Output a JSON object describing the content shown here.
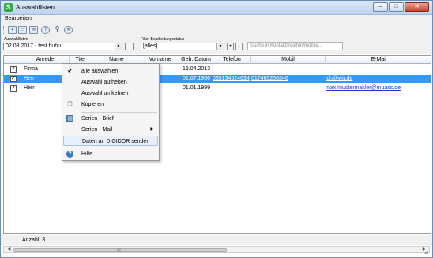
{
  "window": {
    "title": "Auswahllisten",
    "app_icon": "S"
  },
  "menu": {
    "items": [
      "Bearbeiten"
    ]
  },
  "toolbar": {
    "icons": [
      "save-icon",
      "print-icon",
      "mail-icon",
      "help-icon",
      "settings-icon",
      "close-circle-icon"
    ]
  },
  "filters": {
    "list_label": "Auswahllisten",
    "list_value": "02.03.2017  -  test huhu",
    "ellipsis_label": "...",
    "status_label": "Filter Bearbeitungsstatus",
    "status_value": "[alles]",
    "plus_label": "+",
    "minus_label": "-",
    "search_placeholder": "Suche in Kontakt/Telefon/mobile..."
  },
  "table": {
    "columns": [
      "Anrede",
      "Titel",
      "Name",
      "Vorname",
      "Geb. Datum",
      "Telefon",
      "Mobil",
      "E-Mail"
    ],
    "rows": [
      {
        "checked": true,
        "anrede": "Firma",
        "geb": "15.04.2013",
        "telefon": "",
        "mobil": "",
        "email": "",
        "selected": false
      },
      {
        "checked": true,
        "anrede": "Herr",
        "geb": "01.07.1956",
        "telefon": "035134524634",
        "mobil": "017465256346",
        "email": "ich@wir.de",
        "selected": true
      },
      {
        "checked": true,
        "anrede": "Herr",
        "geb": "01.01.1999",
        "telefon": "",
        "mobil": "",
        "email": "max.mustermakler@muass.de",
        "selected": false
      }
    ]
  },
  "context_menu": {
    "items": [
      {
        "label": "alle auswählen",
        "icon": "check-icon"
      },
      {
        "label": "Auswahl aufheben"
      },
      {
        "label": "Auswahl umkehren"
      },
      {
        "label": "Kopieren",
        "icon": "copy-icon"
      },
      {
        "label": "Serien - Brief",
        "icon": "letter-icon"
      },
      {
        "label": "Serien - Mail",
        "submenu": true
      },
      {
        "label": "Daten an DIGIDOR senden",
        "hover": true
      },
      {
        "label": "Hilfe",
        "icon": "help-icon"
      }
    ]
  },
  "status": {
    "count_text": "Anzahl: 3"
  },
  "colors": {
    "selection": "#3399ff",
    "link": "#1a3bd6",
    "title_gradient_top": "#dbe8f7"
  }
}
